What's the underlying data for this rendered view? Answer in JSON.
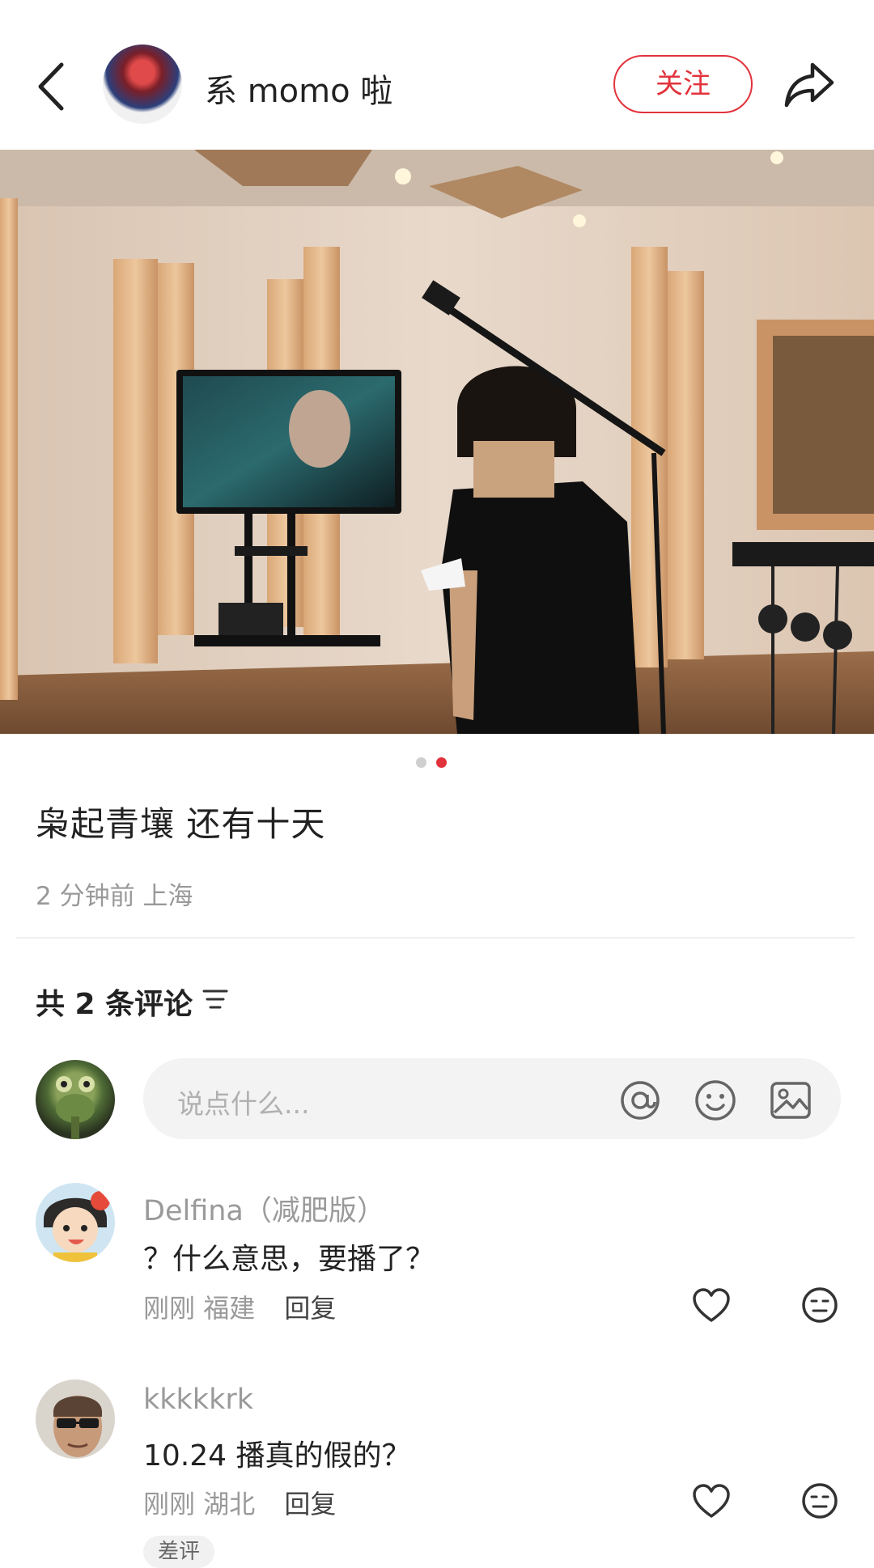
{
  "header": {
    "username": "系 momo 啦",
    "follow_label": "关注"
  },
  "post": {
    "caption": "枭起青壤 还有十天",
    "meta": "2 分钟前 上海",
    "carousel": {
      "count": 2,
      "active": 2
    }
  },
  "comments_section": {
    "count_label": "共 2 条评论",
    "input_placeholder": "说点什么...",
    "items": [
      {
        "name": "Delfina（减肥版）",
        "text": "？什么意思，要播了？",
        "time": "刚刚",
        "location": "福建",
        "reply": "回复"
      },
      {
        "name": "kkkkkrk",
        "text": "10.24 播真的假的？",
        "time": "刚刚",
        "location": "湖北",
        "reply": "回复"
      }
    ],
    "bottom_tag": "差评"
  },
  "colors": {
    "accent": "#e2323c"
  }
}
